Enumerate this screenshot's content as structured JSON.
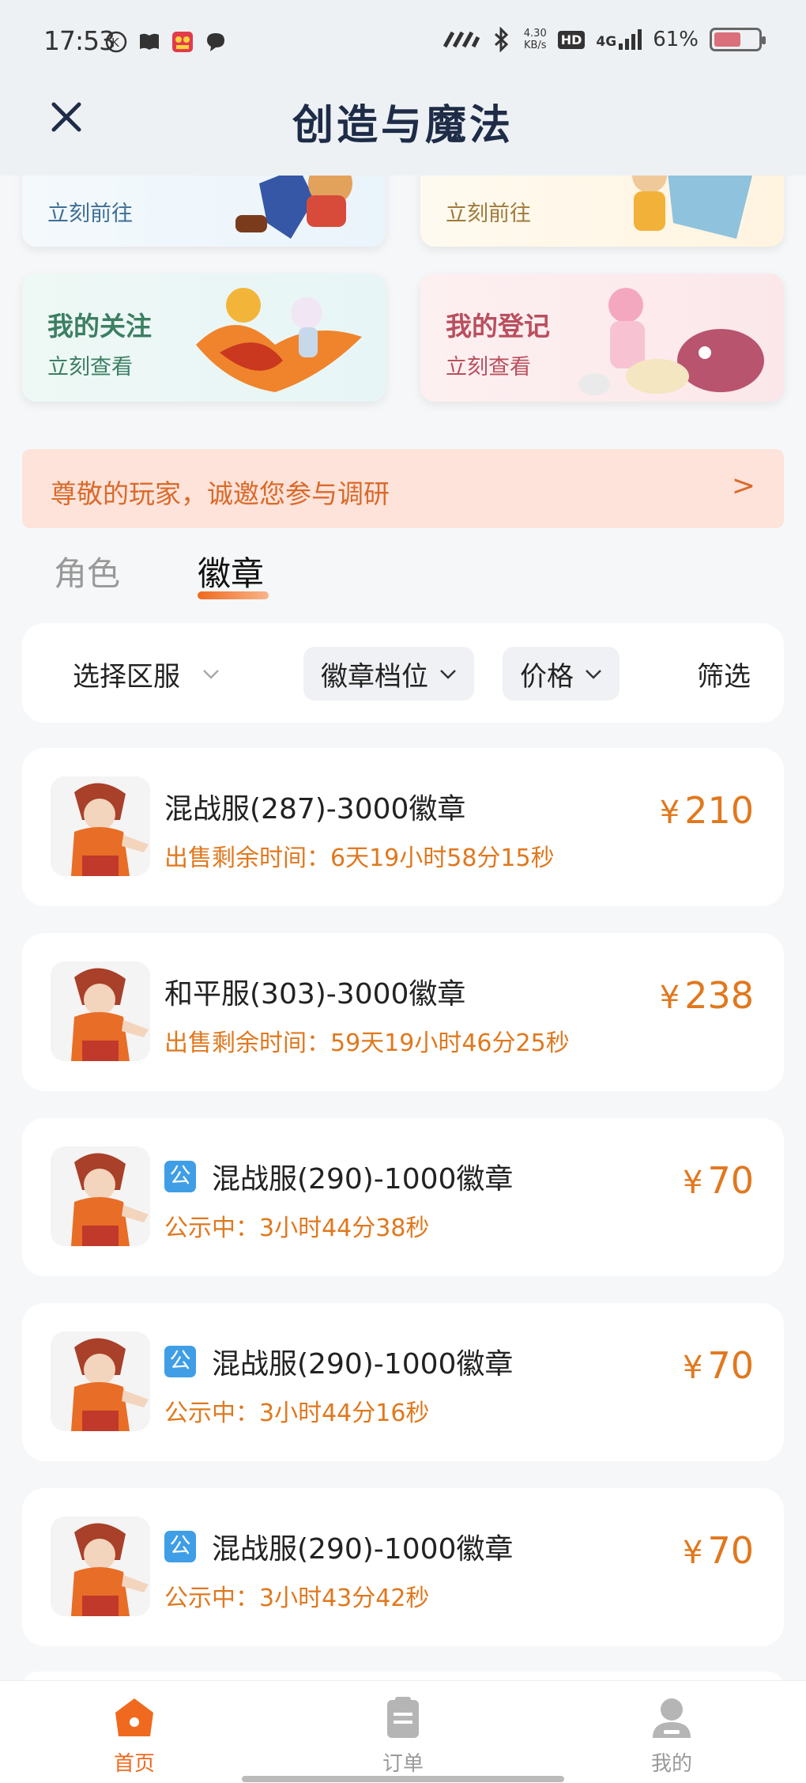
{
  "status_bar": {
    "time": "17:53",
    "net_speed_value": "4.30",
    "net_speed_unit": "KB/s",
    "hd": "HD",
    "signal": "4G",
    "battery": "61%",
    "battery_level": 0.61
  },
  "header": {
    "title": "创造与魔法"
  },
  "shortcuts": [
    {
      "title": "",
      "subtitle": "立刻前往",
      "color": "#3e6f96"
    },
    {
      "title": "",
      "subtitle": "立刻前往",
      "color": "#a07a3a"
    },
    {
      "title": "我的关注",
      "subtitle": "立刻查看",
      "color": "#3c7f62"
    },
    {
      "title": "我的登记",
      "subtitle": "立刻查看",
      "color": "#b94f5e"
    }
  ],
  "survey": {
    "text": "尊敬的玩家，诚邀您参与调研",
    "arrow": ">"
  },
  "tabs": [
    {
      "label": "角色"
    },
    {
      "label": "徽章"
    }
  ],
  "filters": {
    "server": "选择区服",
    "tier": "徽章档位",
    "price": "价格",
    "more": "筛选"
  },
  "listings": [
    {
      "title": "混战服(287)-3000徽章",
      "sub": "出售剩余时间：6天19小时58分15秒",
      "currency": "¥",
      "price": "210",
      "public": false,
      "badge": ""
    },
    {
      "title": "和平服(303)-3000徽章",
      "sub": "出售剩余时间：59天19小时46分25秒",
      "currency": "¥",
      "price": "238",
      "public": false,
      "badge": ""
    },
    {
      "title": "混战服(290)-1000徽章",
      "sub": "公示中：3小时44分38秒",
      "currency": "¥",
      "price": "70",
      "public": true,
      "badge": "公"
    },
    {
      "title": "混战服(290)-1000徽章",
      "sub": "公示中：3小时44分16秒",
      "currency": "¥",
      "price": "70",
      "public": true,
      "badge": "公"
    },
    {
      "title": "混战服(290)-1000徽章",
      "sub": "公示中：3小时43分42秒",
      "currency": "¥",
      "price": "70",
      "public": true,
      "badge": "公"
    }
  ],
  "bottom_nav": [
    {
      "label": "首页",
      "icon": "home-icon",
      "active": true
    },
    {
      "label": "订单",
      "icon": "clipboard-icon",
      "active": false
    },
    {
      "label": "我的",
      "icon": "user-icon",
      "active": false
    }
  ],
  "colors": {
    "accent": "#e0781e",
    "active_nav": "#ef6a1f",
    "inactive_nav": "#9a9a9a",
    "public_badge": "#3f9ee6"
  }
}
